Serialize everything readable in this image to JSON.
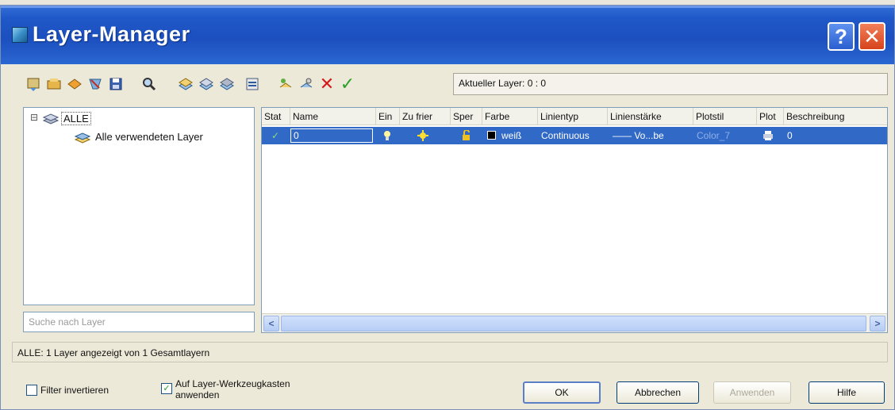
{
  "window": {
    "title": "Layer-Manager",
    "help_symbol": "?",
    "close_symbol": "✕"
  },
  "toolbar": {
    "icons": [
      "new-property-filter-icon",
      "new-group-filter-icon",
      "layer-states-icon",
      "layer-status-icon",
      "save-icon",
      "search-icon",
      "new-layer-icon",
      "new-layer-vp-frozen-icon",
      "delete-layer-icon",
      "set-current-icon",
      "refresh-icon",
      "settings-icon",
      "delete-icon",
      "set-current-check-icon"
    ],
    "current_layer_label": "Aktueller Layer: 0 : 0"
  },
  "tree": {
    "root_label": "ALLE",
    "child_label": "Alle verwendeten Layer",
    "expander": "⊟"
  },
  "search": {
    "placeholder": "Suche nach Layer"
  },
  "grid": {
    "columns": [
      "Stat",
      "Name",
      "Ein",
      "Zu frier",
      "Sper",
      "Farbe",
      "Linientyp",
      "Linienstärke",
      "Plotstil",
      "Plot",
      "Beschreibung"
    ],
    "rows": [
      {
        "status": "✓",
        "name": "0",
        "color_name": "weiß",
        "linetype": "Continuous",
        "lineweight": "—— Vo...be",
        "plotstyle": "Color_7",
        "description": "0"
      }
    ],
    "scroll_left": "<",
    "scroll_right": ">"
  },
  "status": {
    "text": "ALLE: 1 Layer angezeigt von 1 Gesamtlayern"
  },
  "options": {
    "invert_filter_label": "Filter invertieren",
    "invert_filter_checked": false,
    "apply_toolbar_label_1": "Auf Layer-Werkzeugkasten",
    "apply_toolbar_label_2": "anwenden",
    "apply_toolbar_checked": true
  },
  "buttons": {
    "ok": "OK",
    "cancel": "Abbrechen",
    "apply": "Anwenden",
    "help": "Hilfe"
  },
  "colors": {
    "title_blue": "#1c4fbf",
    "selection_blue": "#3169c6",
    "dialog_bg": "#ece9d8"
  }
}
